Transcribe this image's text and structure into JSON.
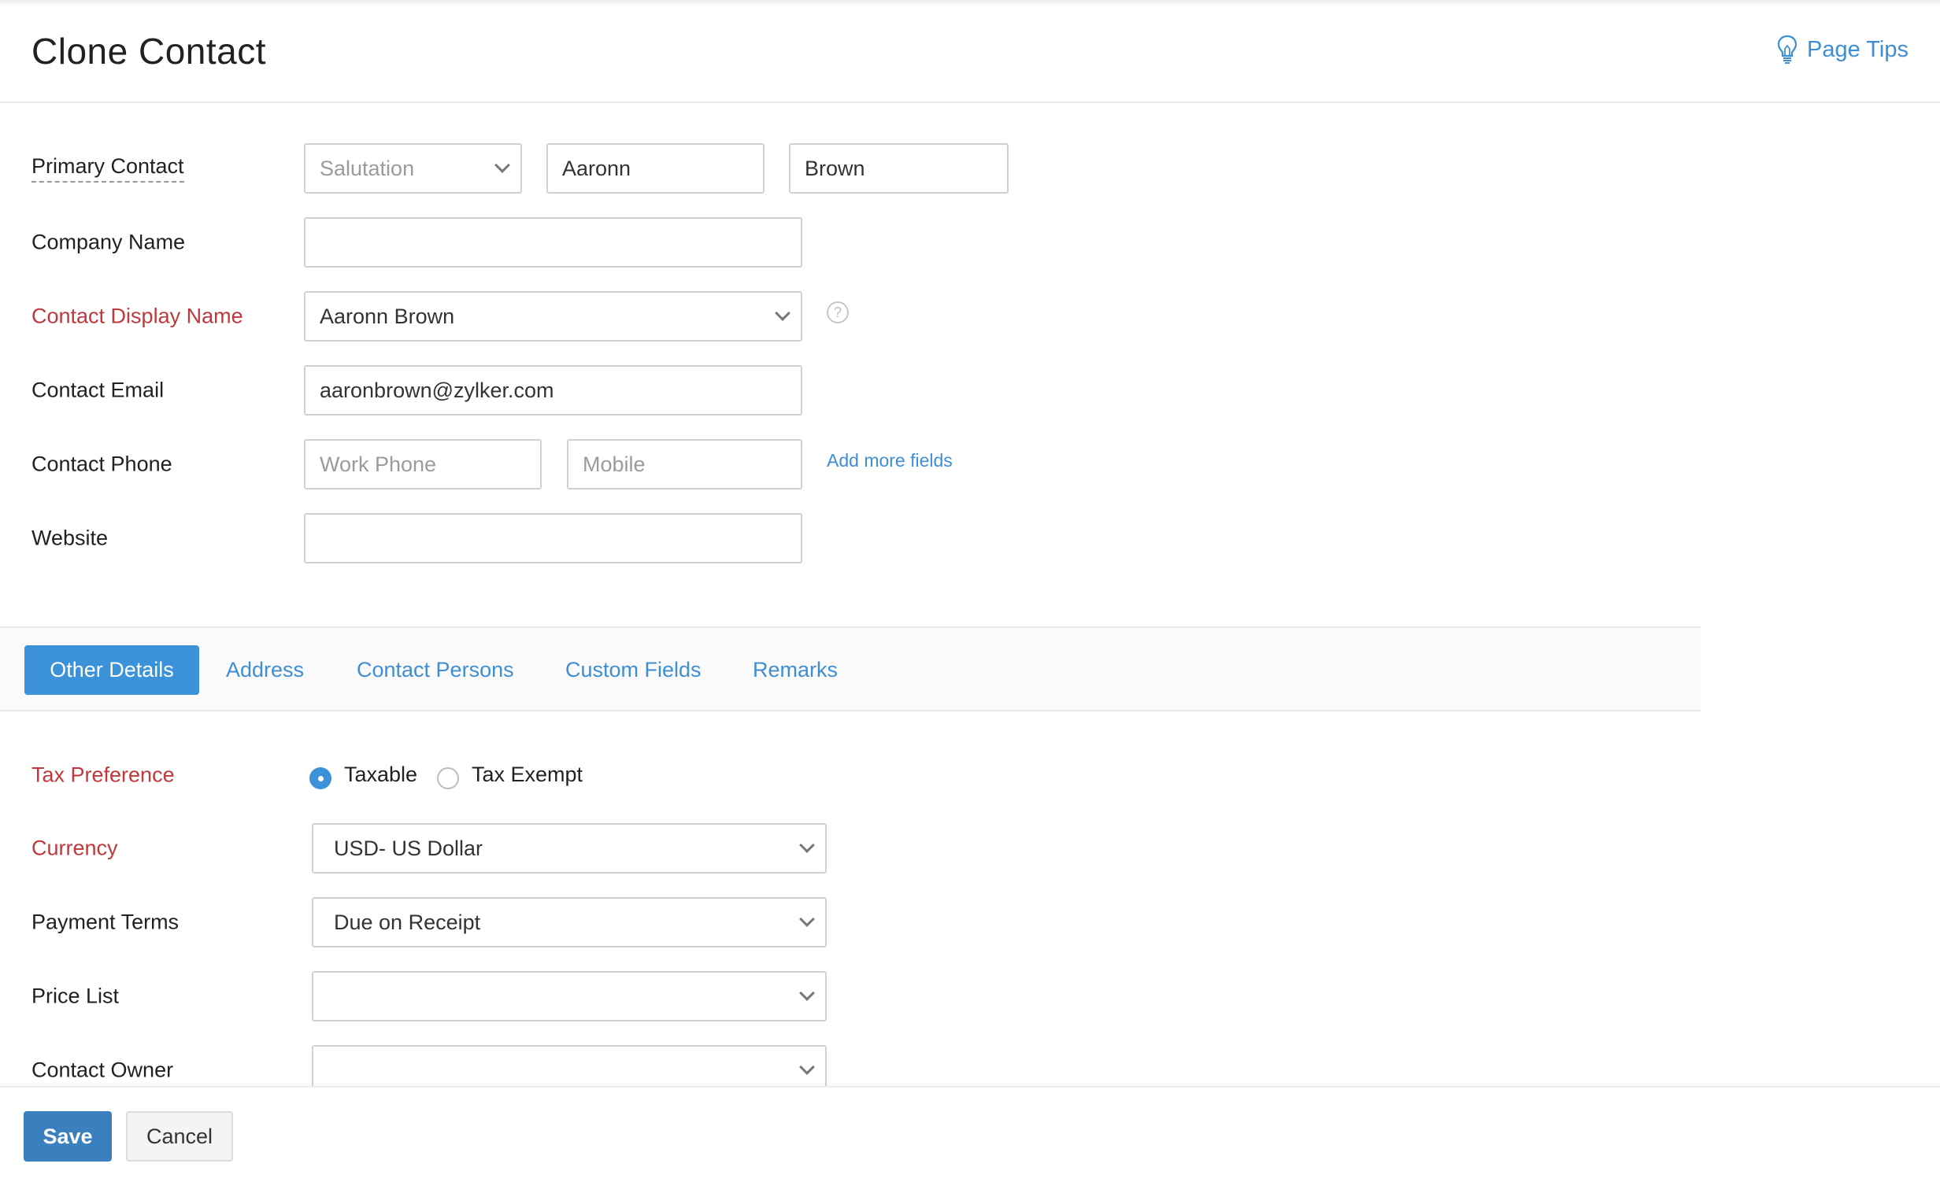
{
  "header": {
    "title": "Clone Contact",
    "page_tips": "Page Tips",
    "page_tips_icon": "lightbulb-icon"
  },
  "form": {
    "primary_contact": {
      "label": "Primary Contact",
      "salutation_placeholder": "Salutation",
      "first_name": "Aaronn",
      "last_name": "Brown"
    },
    "company_name": {
      "label": "Company Name",
      "value": ""
    },
    "display_name": {
      "label": "Contact Display Name",
      "value": "Aaronn Brown",
      "help_icon": "?"
    },
    "email": {
      "label": "Contact Email",
      "value": "aaronbrown@zylker.com"
    },
    "phone": {
      "label": "Contact Phone",
      "work_placeholder": "Work Phone",
      "mobile_placeholder": "Mobile",
      "add_more": "Add more fields"
    },
    "website": {
      "label": "Website",
      "value": ""
    }
  },
  "tabs": [
    {
      "label": "Other Details",
      "active": true
    },
    {
      "label": "Address",
      "active": false
    },
    {
      "label": "Contact Persons",
      "active": false
    },
    {
      "label": "Custom Fields",
      "active": false
    },
    {
      "label": "Remarks",
      "active": false
    }
  ],
  "other_details": {
    "tax_preference": {
      "label": "Tax Preference",
      "options": [
        "Taxable",
        "Tax Exempt"
      ],
      "selected": "Taxable"
    },
    "currency": {
      "label": "Currency",
      "value": "USD- US Dollar"
    },
    "payment_terms": {
      "label": "Payment Terms",
      "value": "Due on Receipt"
    },
    "price_list": {
      "label": "Price List",
      "value": ""
    },
    "contact_owner": {
      "label": "Contact Owner",
      "value": ""
    }
  },
  "footer": {
    "save": "Save",
    "cancel": "Cancel"
  },
  "colors": {
    "accent": "#3b92d9",
    "required_label": "#c0383c",
    "link": "#3f8ed3",
    "save_button": "#3a80be"
  }
}
